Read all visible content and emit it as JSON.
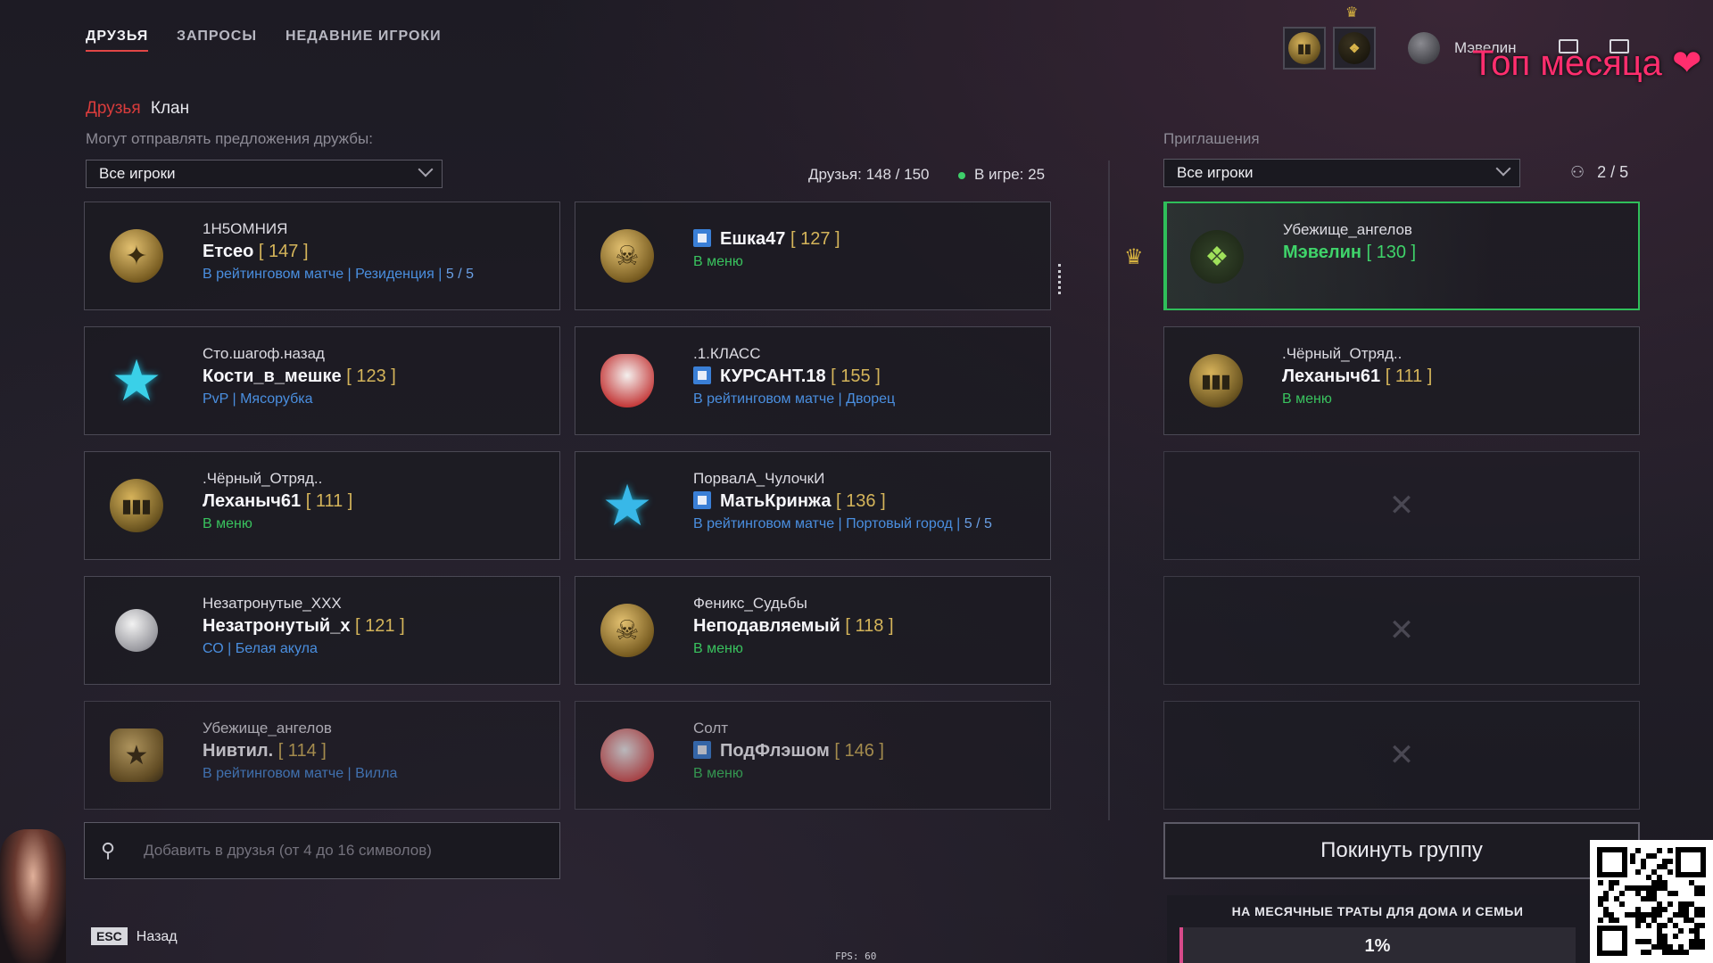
{
  "nav": {
    "tabs": [
      {
        "label": "ДРУЗЬЯ",
        "active": true
      },
      {
        "label": "ЗАПРОСЫ",
        "active": false
      },
      {
        "label": "НЕДАВНИЕ ИГРОКИ",
        "active": false
      }
    ]
  },
  "header": {
    "profile_name": "Мэвелин",
    "overlay_text": "Топ месяца ❤"
  },
  "subtabs": {
    "friends": "Друзья",
    "clan": "Клан"
  },
  "left": {
    "filter_caption": "Могут отправлять предложения дружбы:",
    "filter_value": "Все игроки",
    "friends_count": "Друзья: 148 / 150",
    "in_game": "В игре: 25"
  },
  "friends": [
    {
      "clan": "1Н5ОМНИЯ",
      "name": "Етсео",
      "level": "[ 147 ]",
      "status": "В рейтинговом матче | Резиденция |",
      "party": "5 / 5",
      "status_color": "blue",
      "icon": "eagle-emblem-icon"
    },
    {
      "clan": "",
      "name": "Ешка47",
      "level": "[ 127 ]",
      "status": "В меню",
      "status_color": "green",
      "icon": "gold-skull-emblem-icon"
    },
    {
      "clan": "Сто.шагоф.назад",
      "name": "Кости_в_мешке",
      "level": "[ 123 ]",
      "status": "PvP | Мясорубка",
      "status_color": "blue",
      "icon": "star-emblem-icon"
    },
    {
      "clan": ".1.КЛАСС",
      "name": "КУРСАНТ.18",
      "level": "[ 155 ]",
      "status": "В рейтинговом матче | Дворец",
      "status_color": "blue",
      "icon": "rabbit-mask-icon"
    },
    {
      "clan": ".Чёрный_Отряд..",
      "name": "Леханыч61",
      "level": "[ 111 ]",
      "status": "В меню",
      "status_color": "green",
      "icon": "gold-coin-emblem-icon"
    },
    {
      "clan": "ПорвалА_ЧулочкИ",
      "name": "МатьКринжа",
      "level": "[ 136 ]",
      "status": "В рейтинговом матче | Портовый город |",
      "party": "5 / 5",
      "status_color": "blue",
      "icon": "star-emblem-icon"
    },
    {
      "clan": "Незатронутые_XXX",
      "name": "Незатронутый_х",
      "level": "[ 121 ]",
      "status": "СО | Белая акула",
      "status_color": "blue",
      "icon": "moon-emblem-icon"
    },
    {
      "clan": "Феникс_Судьбы",
      "name": "Неподавляемый",
      "level": "[ 118 ]",
      "status": "В меню",
      "status_color": "green",
      "icon": "gold-skull-emblem-icon"
    },
    {
      "clan": "Убежище_ангелов",
      "name": "Нивтил.",
      "level": "[ 114 ]",
      "status": "В рейтинговом матче | Вилла",
      "status_color": "blue",
      "icon": "shield-star-emblem-icon"
    },
    {
      "clan": "Солт",
      "name": "ПодФлэшом",
      "level": "[ 146 ]",
      "status": "В меню",
      "status_color": "green",
      "icon": "duck-emblem-icon"
    }
  ],
  "right": {
    "caption": "Приглашения",
    "filter_value": "Все игроки",
    "group_count": "2 / 5",
    "members": [
      {
        "clan": "Убежище_ангелов",
        "name": "Мэвелин",
        "level": "[ 130 ]",
        "status": "",
        "icon": "bat-emblem-icon"
      },
      {
        "clan": ".Чёрный_Отряд..",
        "name": "Леханыч61",
        "level": "[ 111 ]",
        "status": "В меню",
        "icon": "gold-coin-emblem-icon"
      }
    ],
    "leave_button": "Покинуть группу"
  },
  "add_friend_placeholder": "Добавить в друзья (от 4 до 16 символов)",
  "footer": {
    "esc_key": "ESC",
    "back_label": "Назад",
    "fps": "FPS: 60"
  },
  "donation": {
    "title": "НА МЕСЯЧНЫЕ ТРАТЫ ДЛЯ ДОМА И СЕМЬИ",
    "percent_label": "1%",
    "progress": 0.01
  },
  "colors": {
    "accent_red": "#d93c3c",
    "online_green": "#39c25e",
    "status_blue": "#4a8fe0",
    "level_gold": "#d4b45a"
  }
}
